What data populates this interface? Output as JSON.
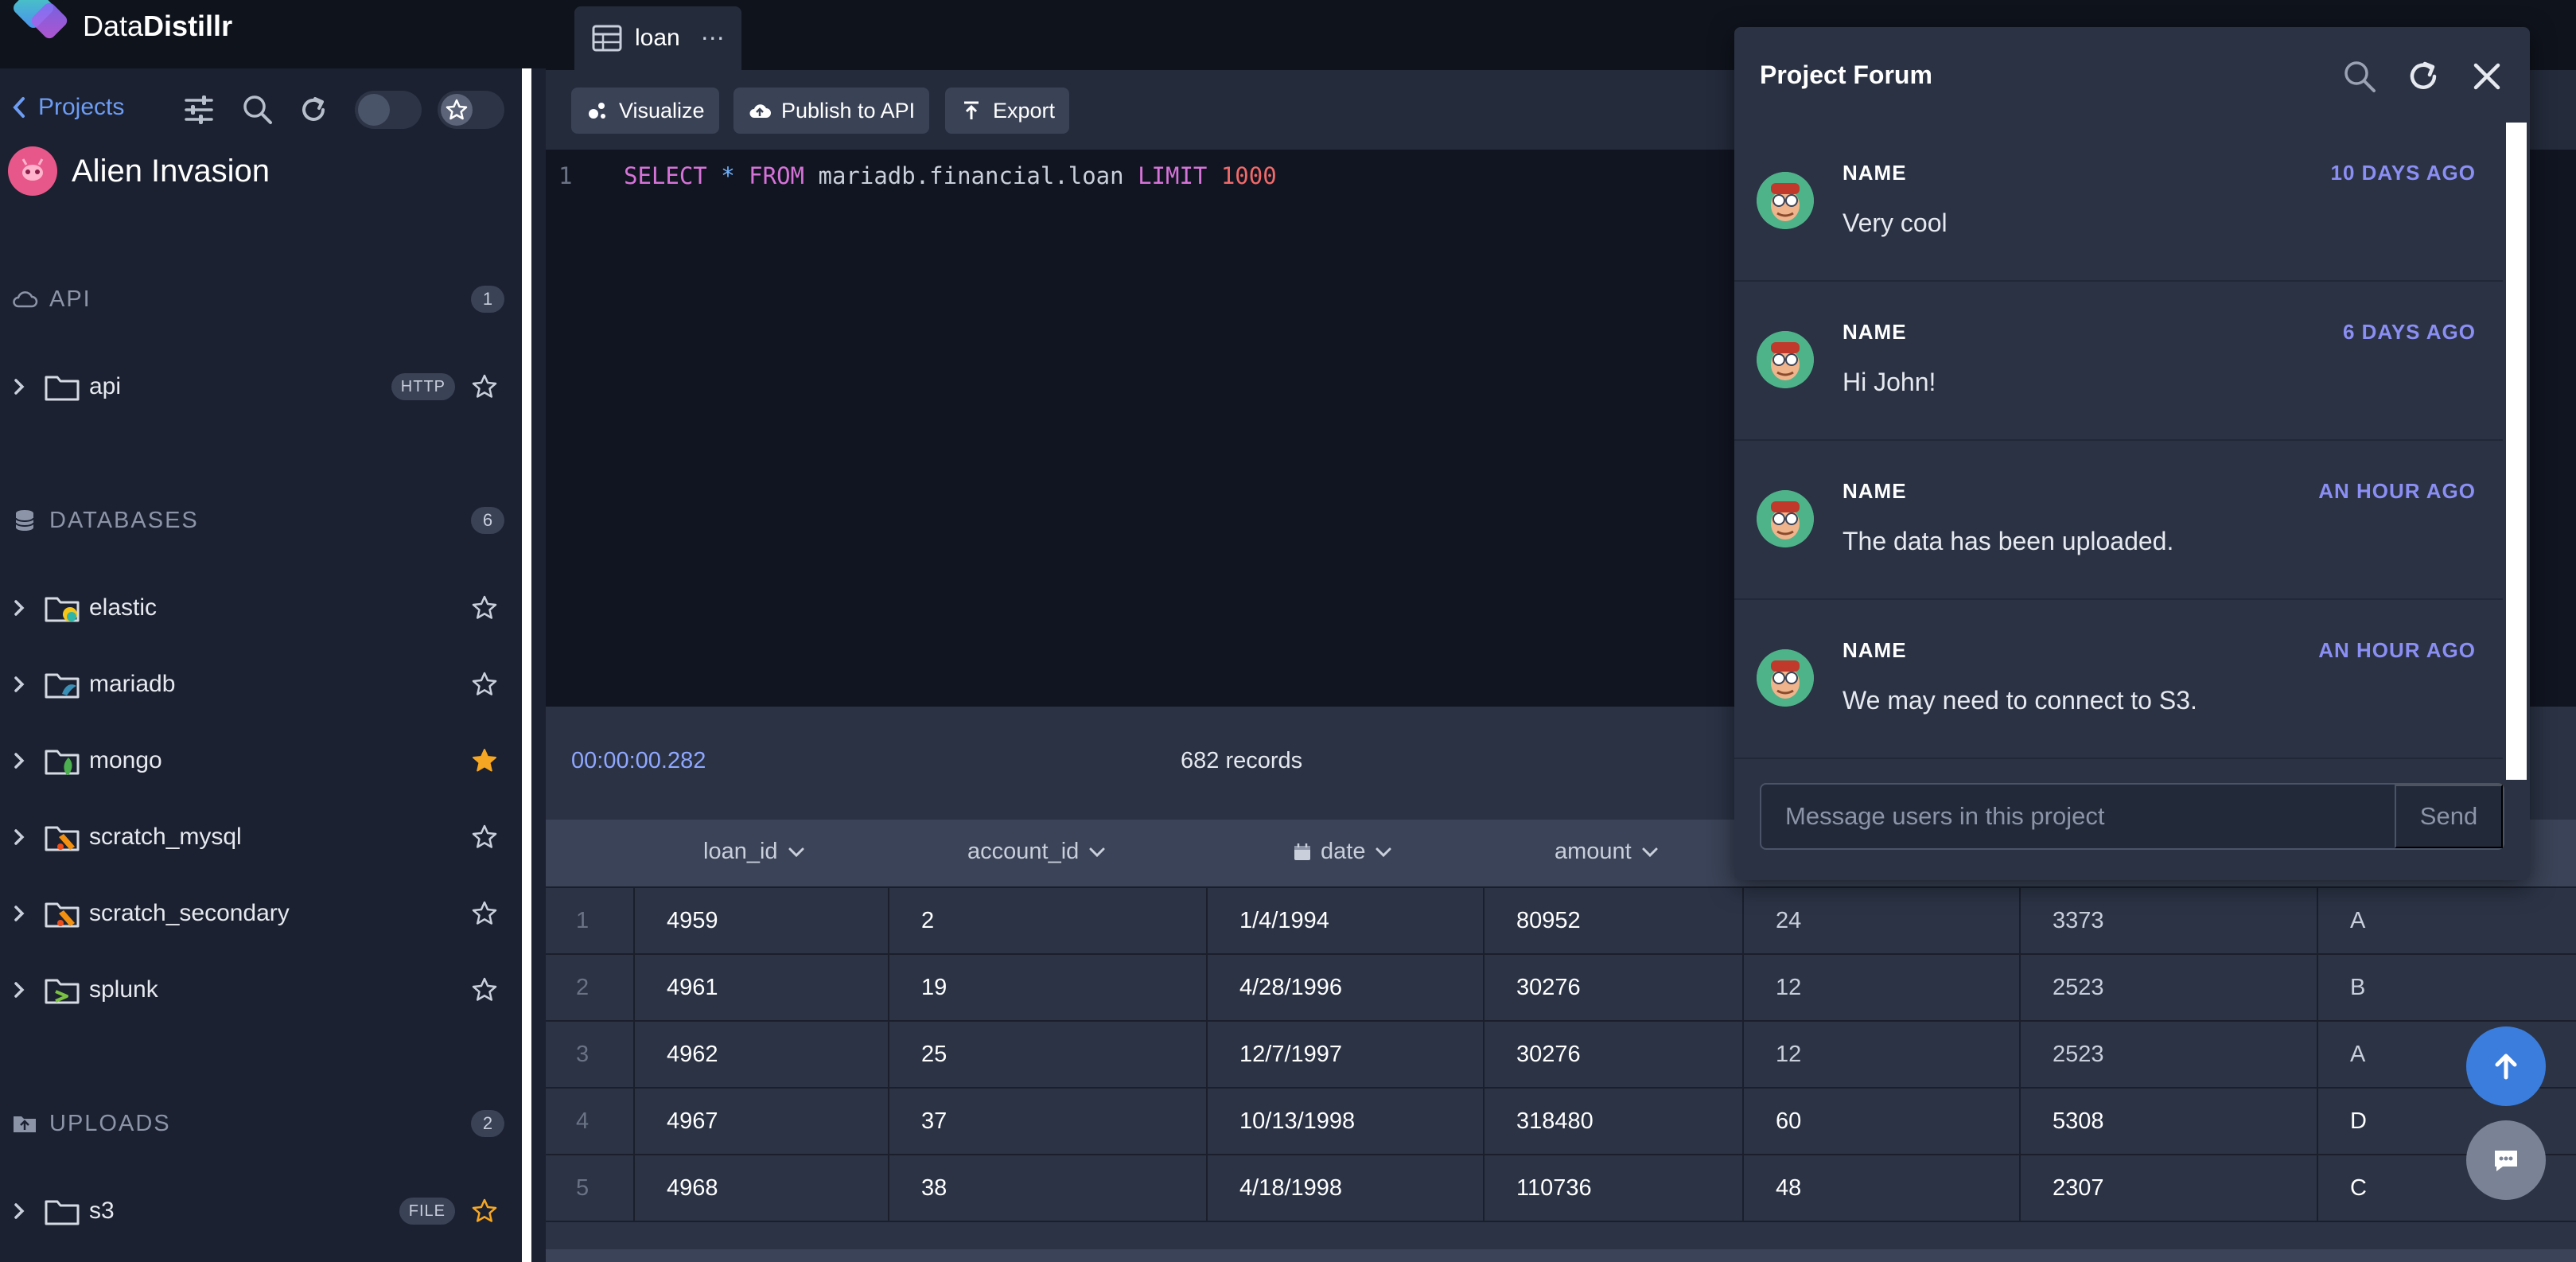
{
  "app": {
    "logo_text_regular": "Data",
    "logo_text_bold": "Distillr",
    "colors": {
      "accent": "#6d9cf4",
      "forum_time": "#8b8ef2",
      "star_active": "#f5a623",
      "fab_primary": "#3b7ddd"
    }
  },
  "sidebar": {
    "projects_label": "Projects",
    "project_name": "Alien Invasion",
    "sections": [
      {
        "title": "API",
        "count": "1",
        "icon": "cloud-icon"
      },
      {
        "title": "DATABASES",
        "count": "6",
        "icon": "database-icon"
      },
      {
        "title": "UPLOADS",
        "count": "2",
        "icon": "upload-folder-icon"
      }
    ],
    "api_items": [
      {
        "label": "api",
        "tag": "HTTP",
        "starred": false
      }
    ],
    "database_items": [
      {
        "label": "elastic",
        "starred": false
      },
      {
        "label": "mariadb",
        "starred": false
      },
      {
        "label": "mongo",
        "starred": true
      },
      {
        "label": "scratch_mysql",
        "starred": false
      },
      {
        "label": "scratch_secondary",
        "starred": false
      },
      {
        "label": "splunk",
        "starred": false
      }
    ],
    "upload_items": [
      {
        "label": "s3",
        "tag": "FILE",
        "starred": true
      }
    ]
  },
  "tab": {
    "label": "loan",
    "menu": "⋯"
  },
  "actions": {
    "visualize": "Visualize",
    "publish": "Publish to API",
    "export": "Export"
  },
  "editor": {
    "line_number": "1",
    "tokens": {
      "select": "SELECT",
      "star": "*",
      "from": "FROM",
      "table": "mariadb.financial.loan",
      "limit": "LIMIT",
      "limit_value": "1000"
    }
  },
  "status": {
    "elapsed": "00:00:00.282",
    "records": "682 records"
  },
  "grid": {
    "columns": [
      "loan_id",
      "account_id",
      "date",
      "amount"
    ],
    "rows": [
      [
        "1",
        "4959",
        "2",
        "1/4/1994",
        "80952",
        "24",
        "3373",
        "A"
      ],
      [
        "2",
        "4961",
        "19",
        "4/28/1996",
        "30276",
        "12",
        "2523",
        "B"
      ],
      [
        "3",
        "4962",
        "25",
        "12/7/1997",
        "30276",
        "12",
        "2523",
        "A"
      ],
      [
        "4",
        "4967",
        "37",
        "10/13/1998",
        "318480",
        "60",
        "5308",
        "D"
      ],
      [
        "5",
        "4968",
        "38",
        "4/18/1998",
        "110736",
        "48",
        "2307",
        "C"
      ]
    ]
  },
  "forum": {
    "title": "Project Forum",
    "posts": [
      {
        "name": "NAME",
        "time": "10 DAYS AGO",
        "text": "Very cool"
      },
      {
        "name": "NAME",
        "time": "6 DAYS AGO",
        "text": "Hi John!"
      },
      {
        "name": "NAME",
        "time": "AN HOUR AGO",
        "text": "The data has been uploaded."
      },
      {
        "name": "NAME",
        "time": "AN HOUR AGO",
        "text": "We may need to connect to S3."
      }
    ],
    "input_placeholder": "Message users in this project",
    "send_label": "Send"
  }
}
